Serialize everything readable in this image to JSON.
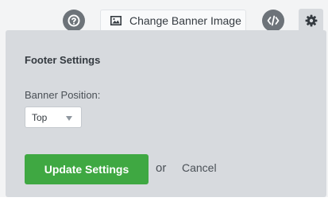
{
  "toolbar": {
    "help_icon": "question-circle-icon",
    "change_banner_label": "Change Banner Image",
    "image_icon": "image-icon",
    "code_icon": "code-icon",
    "settings_icon": "gear-icon"
  },
  "panel": {
    "title": "Footer Settings",
    "banner_position_label": "Banner Position:",
    "banner_position_value": "Top",
    "update_button": "Update Settings",
    "or_text": "or",
    "cancel_link": "Cancel"
  },
  "colors": {
    "panel_bg": "#d7dade",
    "update_button": "#3fa842",
    "icon_button": "#6d7379"
  }
}
